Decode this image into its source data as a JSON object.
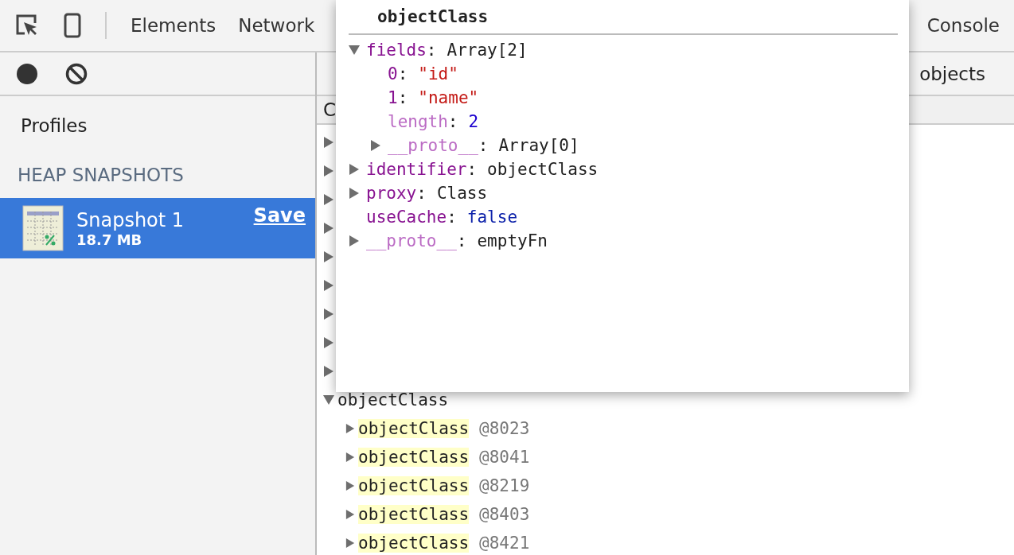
{
  "toolbar": {
    "tabs": [
      {
        "label": "Elements"
      },
      {
        "label": "Network"
      },
      {
        "label": "Console"
      }
    ]
  },
  "sidebar": {
    "title": "Profiles",
    "section": "HEAP SNAPSHOTS",
    "snapshots": [
      {
        "name": "Snapshot 1",
        "size": "18.7 MB",
        "action": "Save",
        "selected": true
      }
    ]
  },
  "summary": {
    "filter": "objects",
    "column_1": "C"
  },
  "rows": [
    {
      "expanded": false
    },
    {
      "expanded": false
    },
    {
      "expanded": false
    },
    {
      "expanded": false
    },
    {
      "expanded": false
    },
    {
      "expanded": false
    },
    {
      "expanded": false
    },
    {
      "expanded": false
    },
    {
      "expanded": false
    },
    {
      "name": "objectClass",
      "expanded": true,
      "children": [
        {
          "name": "objectClass",
          "id": "@8023",
          "expanded": false,
          "highlighted": true
        },
        {
          "name": "objectClass",
          "id": "@8041",
          "expanded": false,
          "highlighted": true
        },
        {
          "name": "objectClass",
          "id": "@8219",
          "expanded": false,
          "highlighted": true
        },
        {
          "name": "objectClass",
          "id": "@8403",
          "expanded": false,
          "highlighted": true
        },
        {
          "name": "objectClass",
          "id": "@8421",
          "expanded": false,
          "highlighted": true
        }
      ]
    }
  ],
  "popover": {
    "title": "objectClass",
    "properties": [
      {
        "key": "fields",
        "separator": ":",
        "value": "Array[2]",
        "kind": "object",
        "dim": false,
        "expanded": true,
        "children": [
          {
            "key": "0",
            "separator": ":",
            "value": "\"id\"",
            "kind": "string",
            "dim": false
          },
          {
            "key": "1",
            "separator": ":",
            "value": "\"name\"",
            "kind": "string",
            "dim": false
          },
          {
            "key": "length",
            "separator": ":",
            "value": "2",
            "kind": "number",
            "dim": true
          },
          {
            "key": "__proto__",
            "separator": ":",
            "value": "Array[0]",
            "kind": "object",
            "dim": true,
            "expanded": false
          }
        ]
      },
      {
        "key": "identifier",
        "separator": ":",
        "value": "objectClass",
        "kind": "object",
        "dim": false,
        "expanded": false
      },
      {
        "key": "proxy",
        "separator": ":",
        "value": "Class",
        "kind": "object",
        "dim": false,
        "expanded": false
      },
      {
        "key": "useCache",
        "separator": ":",
        "value": "false",
        "kind": "keyword",
        "dim": false
      },
      {
        "key": "__proto__",
        "separator": ":",
        "value": "emptyFn",
        "kind": "object",
        "dim": true,
        "expanded": false
      }
    ]
  }
}
